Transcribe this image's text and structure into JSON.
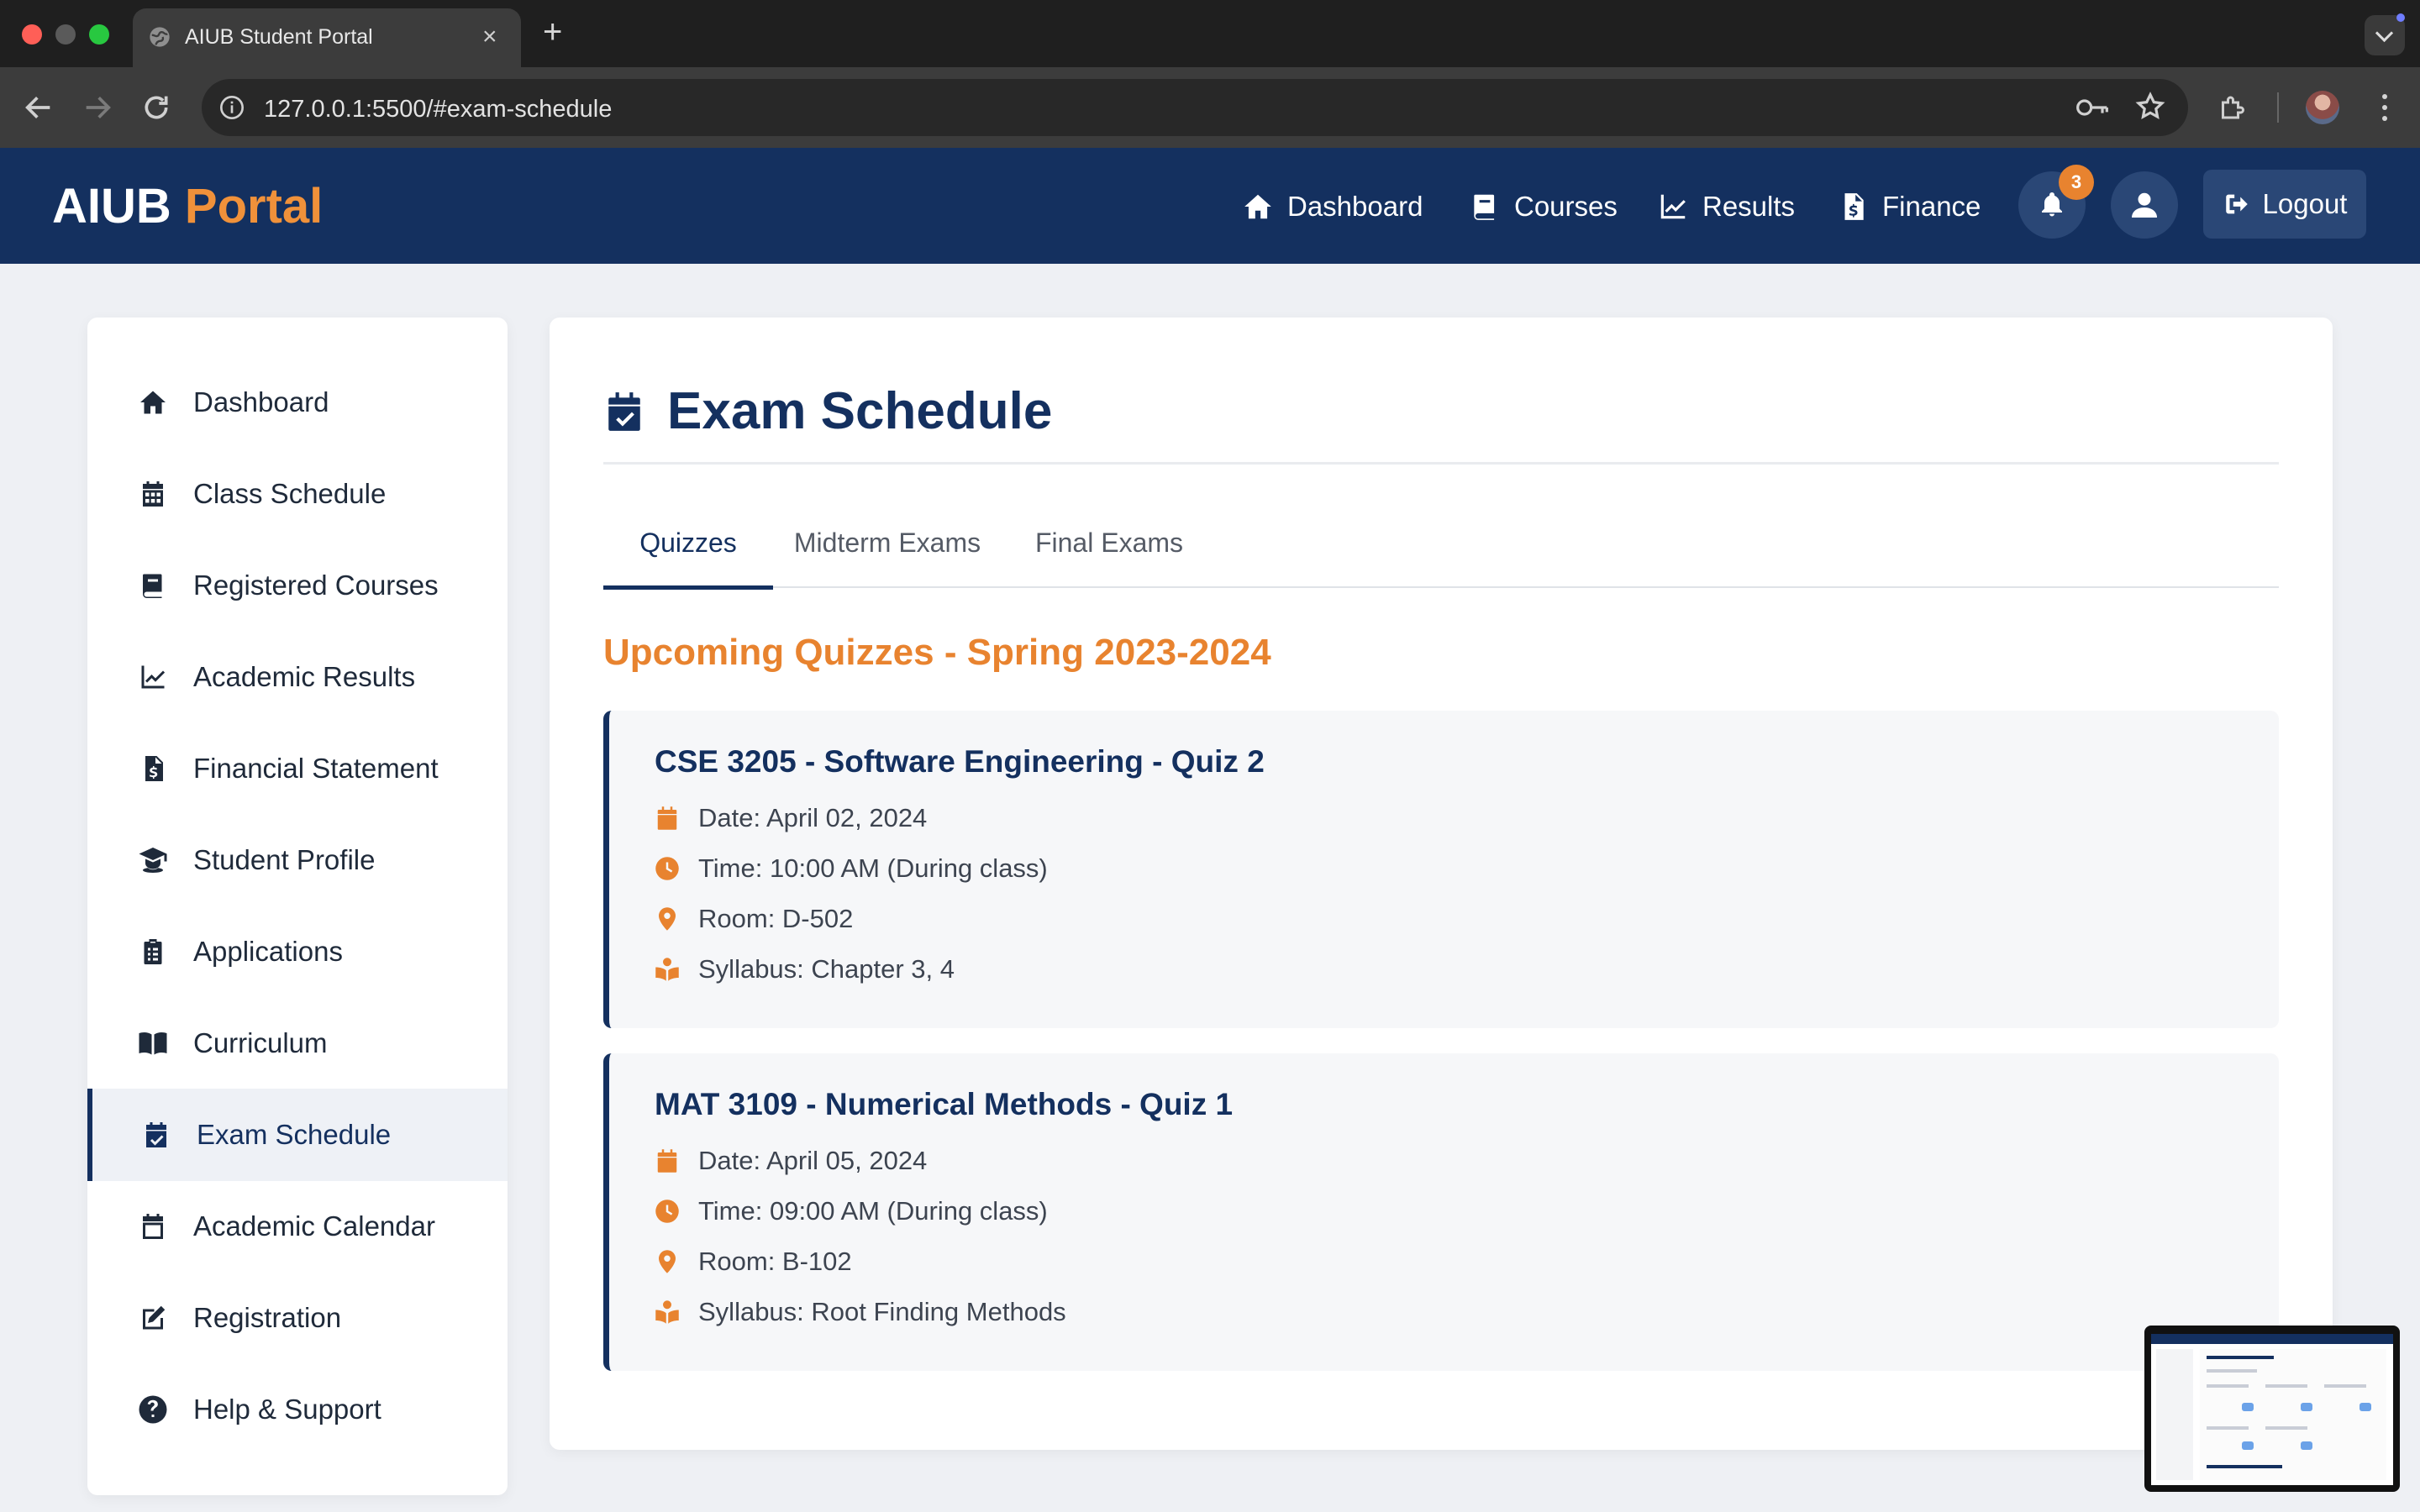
{
  "browser": {
    "tab_title": "AIUB Student Portal",
    "tab_close": "×",
    "new_tab": "+",
    "url": "127.0.0.1:5500/#exam-schedule"
  },
  "header": {
    "brand_part1": "AIUB",
    "brand_part2": "Portal",
    "nav": [
      {
        "label": "Dashboard",
        "icon": "home-icon"
      },
      {
        "label": "Courses",
        "icon": "book-icon"
      },
      {
        "label": "Results",
        "icon": "chart-line-icon"
      },
      {
        "label": "Finance",
        "icon": "invoice-dollar-icon"
      }
    ],
    "notification_count": "3",
    "logout_label": "Logout"
  },
  "sidebar": {
    "items": [
      {
        "label": "Dashboard",
        "icon": "home-icon"
      },
      {
        "label": "Class Schedule",
        "icon": "calendar-grid-icon"
      },
      {
        "label": "Registered Courses",
        "icon": "book-icon"
      },
      {
        "label": "Academic Results",
        "icon": "chart-line-icon"
      },
      {
        "label": "Financial Statement",
        "icon": "invoice-dollar-icon"
      },
      {
        "label": "Student Profile",
        "icon": "graduate-icon"
      },
      {
        "label": "Applications",
        "icon": "clipboard-icon"
      },
      {
        "label": "Curriculum",
        "icon": "book-open-icon"
      },
      {
        "label": "Exam Schedule",
        "icon": "calendar-check-icon",
        "active": true
      },
      {
        "label": "Academic Calendar",
        "icon": "calendar-icon"
      },
      {
        "label": "Registration",
        "icon": "edit-icon"
      },
      {
        "label": "Help & Support",
        "icon": "question-circle-icon"
      }
    ]
  },
  "main": {
    "title": "Exam Schedule",
    "tabs": [
      {
        "label": "Quizzes",
        "active": true
      },
      {
        "label": "Midterm Exams"
      },
      {
        "label": "Final Exams"
      }
    ],
    "section_title": "Upcoming Quizzes - Spring 2023-2024",
    "quizzes": [
      {
        "title": "CSE 3205 - Software Engineering - Quiz 2",
        "date": "Date: April 02, 2024",
        "time": "Time: 10:00 AM (During class)",
        "room": "Room: D-502",
        "syllabus": "Syllabus: Chapter 3, 4"
      },
      {
        "title": "MAT 3109 - Numerical Methods - Quiz 1",
        "date": "Date: April 05, 2024",
        "time": "Time: 09:00 AM (During class)",
        "room": "Room: B-102",
        "syllabus": "Syllabus: Root Finding Methods"
      }
    ]
  },
  "colors": {
    "primary": "#14305f",
    "accent": "#e8832f",
    "background": "#eef0f4"
  }
}
